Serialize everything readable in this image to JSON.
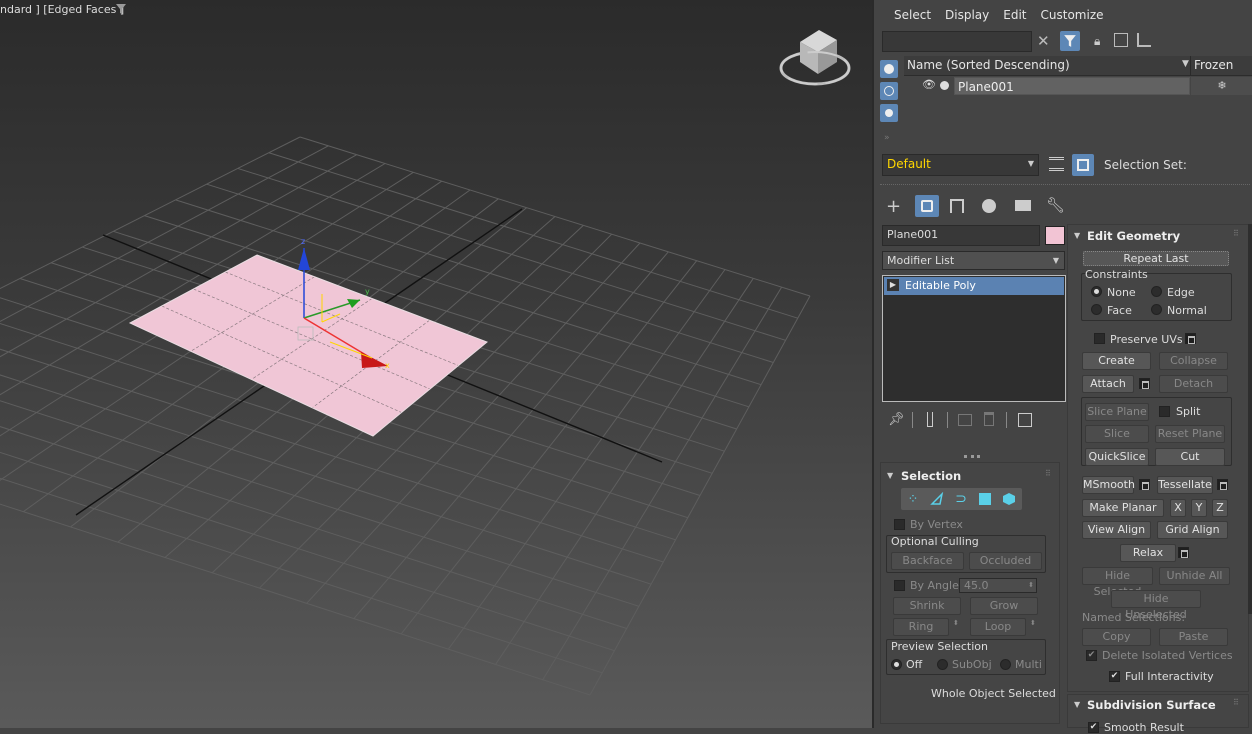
{
  "viewport": {
    "label": "ndard ] [Edged Faces ]"
  },
  "scene_explorer": {
    "menu": [
      "Select",
      "Display",
      "Edit",
      "Customize"
    ],
    "column_name": "Name (Sorted Descending)",
    "column_frozen": "Frozen",
    "object_name": "Plane001",
    "layer": "Default",
    "selection_set_label": "Selection Set:"
  },
  "command_panel": {
    "object_name": "Plane001",
    "object_color": "#f2c4d4",
    "modifier_list": "Modifier List",
    "stack_item": "Editable Poly"
  },
  "selection": {
    "title": "Selection",
    "by_vertex": "By Vertex",
    "optional_culling": "Optional Culling",
    "backface": "Backface",
    "occluded": "Occluded",
    "by_angle": "By Angle:",
    "angle_value": "45.0",
    "shrink": "Shrink",
    "grow": "Grow",
    "ring": "Ring",
    "loop": "Loop",
    "preview_selection": "Preview Selection",
    "off": "Off",
    "subobj": "SubObj",
    "multi": "Multi",
    "status": "Whole Object Selected"
  },
  "edit_geometry": {
    "title": "Edit Geometry",
    "repeat_last": "Repeat Last",
    "constraints": "Constraints",
    "none": "None",
    "edge": "Edge",
    "face": "Face",
    "normal": "Normal",
    "preserve_uvs": "Preserve UVs",
    "create": "Create",
    "collapse": "Collapse",
    "attach": "Attach",
    "detach": "Detach",
    "slice_plane": "Slice Plane",
    "split": "Split",
    "slice": "Slice",
    "reset_plane": "Reset Plane",
    "quickslice": "QuickSlice",
    "cut": "Cut",
    "msmooth": "MSmooth",
    "tessellate": "Tessellate",
    "make_planar": "Make Planar",
    "x": "X",
    "y": "Y",
    "z": "Z",
    "view_align": "View Align",
    "grid_align": "Grid Align",
    "relax": "Relax",
    "hide_selected": "Hide Selected",
    "unhide_all": "Unhide All",
    "hide_unselected": "Hide Unselected",
    "named_selections": "Named Selections:",
    "copy": "Copy",
    "paste": "Paste",
    "delete_isolated": "Delete Isolated Vertices",
    "full_interactivity": "Full Interactivity"
  },
  "subdivision": {
    "title": "Subdivision Surface",
    "smooth_result": "Smooth Result"
  },
  "colors": {
    "accent": "#5d87b6",
    "selected_row": "#5b82b2",
    "layer_text": "#ffd700",
    "plane": "#f0c6d6"
  }
}
